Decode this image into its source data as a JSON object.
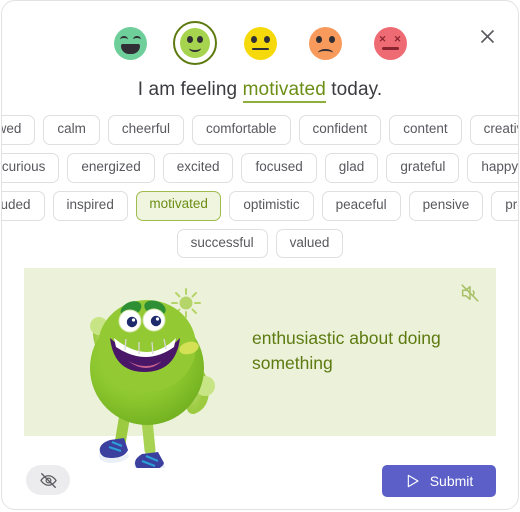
{
  "window": {
    "close_label": "✕",
    "close_icon": "close-icon"
  },
  "mood_scale": {
    "icon_name": "emoji-rating-scale",
    "options": [
      {
        "label": "very-happy",
        "icon": "grinning-face-icon",
        "color": "#6ecf9a",
        "selected": false
      },
      {
        "label": "happy",
        "icon": "smiling-face-icon",
        "color": "#a7d44e",
        "selected": true
      },
      {
        "label": "neutral",
        "icon": "neutral-face-icon",
        "color": "#f5d90a",
        "selected": false
      },
      {
        "label": "sad",
        "icon": "frowning-face-icon",
        "color": "#f79a5b",
        "selected": false
      },
      {
        "label": "angry",
        "icon": "confounded-face-icon",
        "color": "#ef6b74",
        "selected": false
      }
    ]
  },
  "sentence": {
    "prefix": "I am feeling ",
    "blank": "motivated",
    "suffix": " today."
  },
  "chips": {
    "rows": [
      [
        "awed",
        "calm",
        "cheerful",
        "comfortable",
        "confident",
        "content",
        "creative"
      ],
      [
        "curious",
        "energized",
        "excited",
        "focused",
        "glad",
        "grateful",
        "happy"
      ],
      [
        "included",
        "inspired",
        "motivated",
        "optimistic",
        "peaceful",
        "pensive",
        "proud"
      ],
      [
        "successful",
        "valued"
      ]
    ],
    "selected": "motivated"
  },
  "definition_card": {
    "text": "enthusiastic about doing something",
    "speaker_icon": "speaker-muted-icon",
    "illustration": "green-monster-character",
    "background_color": "#ecf2da",
    "text_color": "#5d7a10"
  },
  "footer": {
    "hide_icon": "eye-slash-icon",
    "submit_label": "Submit",
    "submit_icon": "send-triangle-icon",
    "submit_color": "#5b5fc7"
  }
}
